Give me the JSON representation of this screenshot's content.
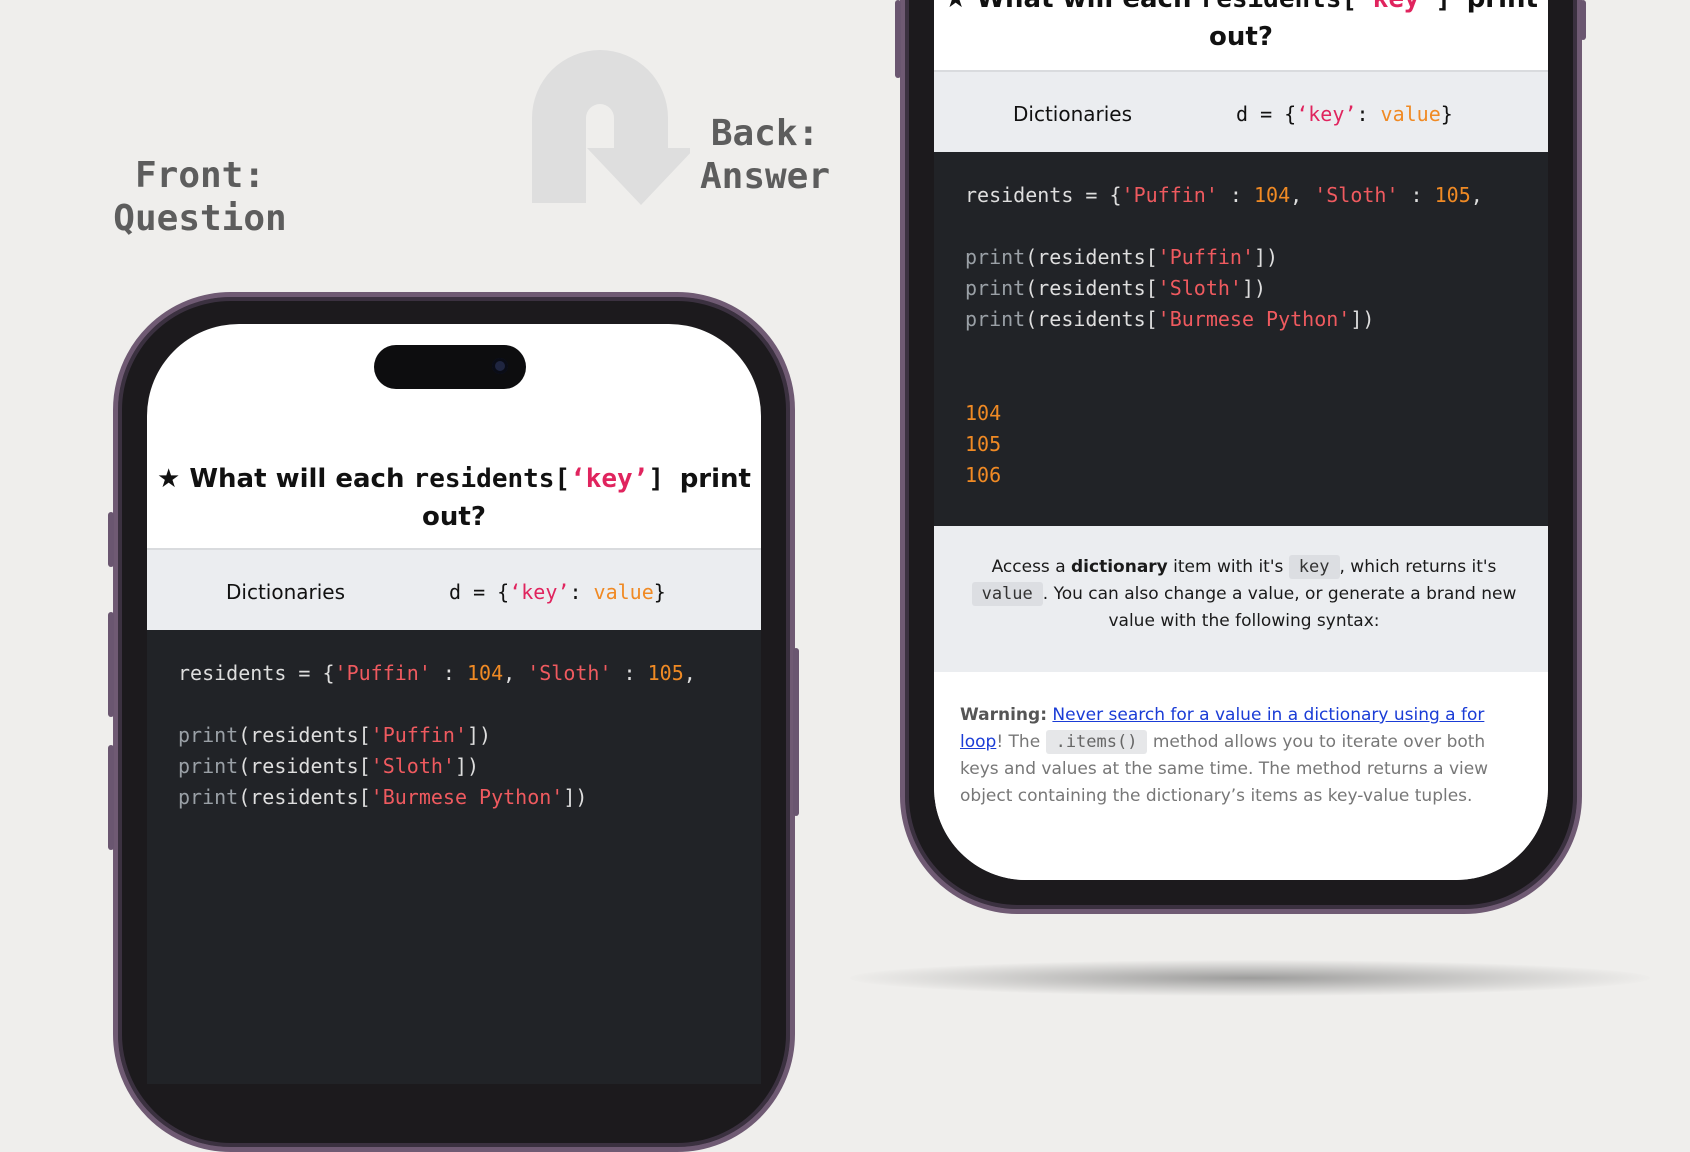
{
  "labels": {
    "front": [
      "Front:",
      "Question"
    ],
    "back": [
      "Back:",
      "Answer"
    ]
  },
  "icons": {
    "flip": "u-turn-arrow-icon",
    "star": "star-icon"
  },
  "card": {
    "title_prefix": "★ What will each",
    "title_code_a": "residents[",
    "title_code_key": "‘key’",
    "title_code_b": "]",
    "title_suffix": "print",
    "title_line2": "out?",
    "topic": "Dictionaries",
    "syntax_a": "d = {",
    "syntax_key": "‘key’",
    "syntax_colon": ": ",
    "syntax_value": "value",
    "syntax_close": "}",
    "code": {
      "l1_a": "residents = {",
      "l1_s1": "'Puffin'",
      "l1_b": " : ",
      "l1_n1": "104",
      "l1_c": ", ",
      "l1_s2": "'Sloth'",
      "l1_d": " : ",
      "l1_n2": "105",
      "l1_e": ",",
      "print_kw": "print",
      "p_open": "(residents[",
      "p_close": "])",
      "p1_str": "'Puffin'",
      "p2_str": "'Sloth'",
      "p3_str": "'Burmese Python'"
    },
    "output": [
      "104",
      "105",
      "106"
    ],
    "explanation": {
      "t1": "Access a ",
      "bold": "dictionary",
      "t2": " item with it's ",
      "key_pill": "key",
      "t3": ", which returns it's ",
      "value_pill": "value",
      "t4": ". You can also change a value, or generate a brand new value with the following syntax:"
    },
    "warning": {
      "label": "Warning:",
      "link": "Never search for a value in a dictionary using a for loop",
      "t1": "! The ",
      "pill": ".items()",
      "t2": " method allows you to iterate over both keys and values at the same time. The method returns a view object containing the dictionary’s items as key-value tuples."
    }
  }
}
